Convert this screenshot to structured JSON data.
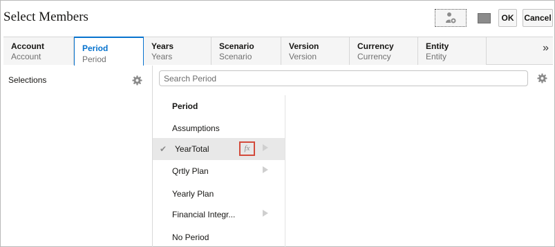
{
  "window": {
    "title": "Select Members"
  },
  "toolbar": {
    "ok_label": "OK",
    "cancel_label": "Cancel"
  },
  "tabs": [
    {
      "label": "Account",
      "sub": "Account",
      "active": false
    },
    {
      "label": "Period",
      "sub": "Period",
      "active": true
    },
    {
      "label": "Years",
      "sub": "Years",
      "active": false
    },
    {
      "label": "Scenario",
      "sub": "Scenario",
      "active": false
    },
    {
      "label": "Version",
      "sub": "Version",
      "active": false
    },
    {
      "label": "Currency",
      "sub": "Currency",
      "active": false
    },
    {
      "label": "Entity",
      "sub": "Entity",
      "active": false
    }
  ],
  "tab_overflow": "»",
  "selections": {
    "label": "Selections"
  },
  "search": {
    "placeholder": "Search Period"
  },
  "members": {
    "header": "Period",
    "items": [
      {
        "label": "Assumptions"
      },
      {
        "label": "YearTotal",
        "selected": true,
        "function_icon": "fx"
      },
      {
        "label": "Qrtly Plan",
        "has_children": true
      },
      {
        "label": "Yearly Plan"
      },
      {
        "label": "Financial Integr...",
        "has_children": true
      },
      {
        "label": "No Period"
      }
    ],
    "check_glyph": "✔"
  },
  "icons": {
    "gear": "gear-icon",
    "user": "user-settings-icon",
    "view": "view-toggle-icon",
    "function": "function-icon",
    "expand": "expand-arrow-icon"
  },
  "colors": {
    "accent": "#0572ce",
    "highlight_border": "#d34a3b",
    "selected_row": "#e8e8e8"
  }
}
